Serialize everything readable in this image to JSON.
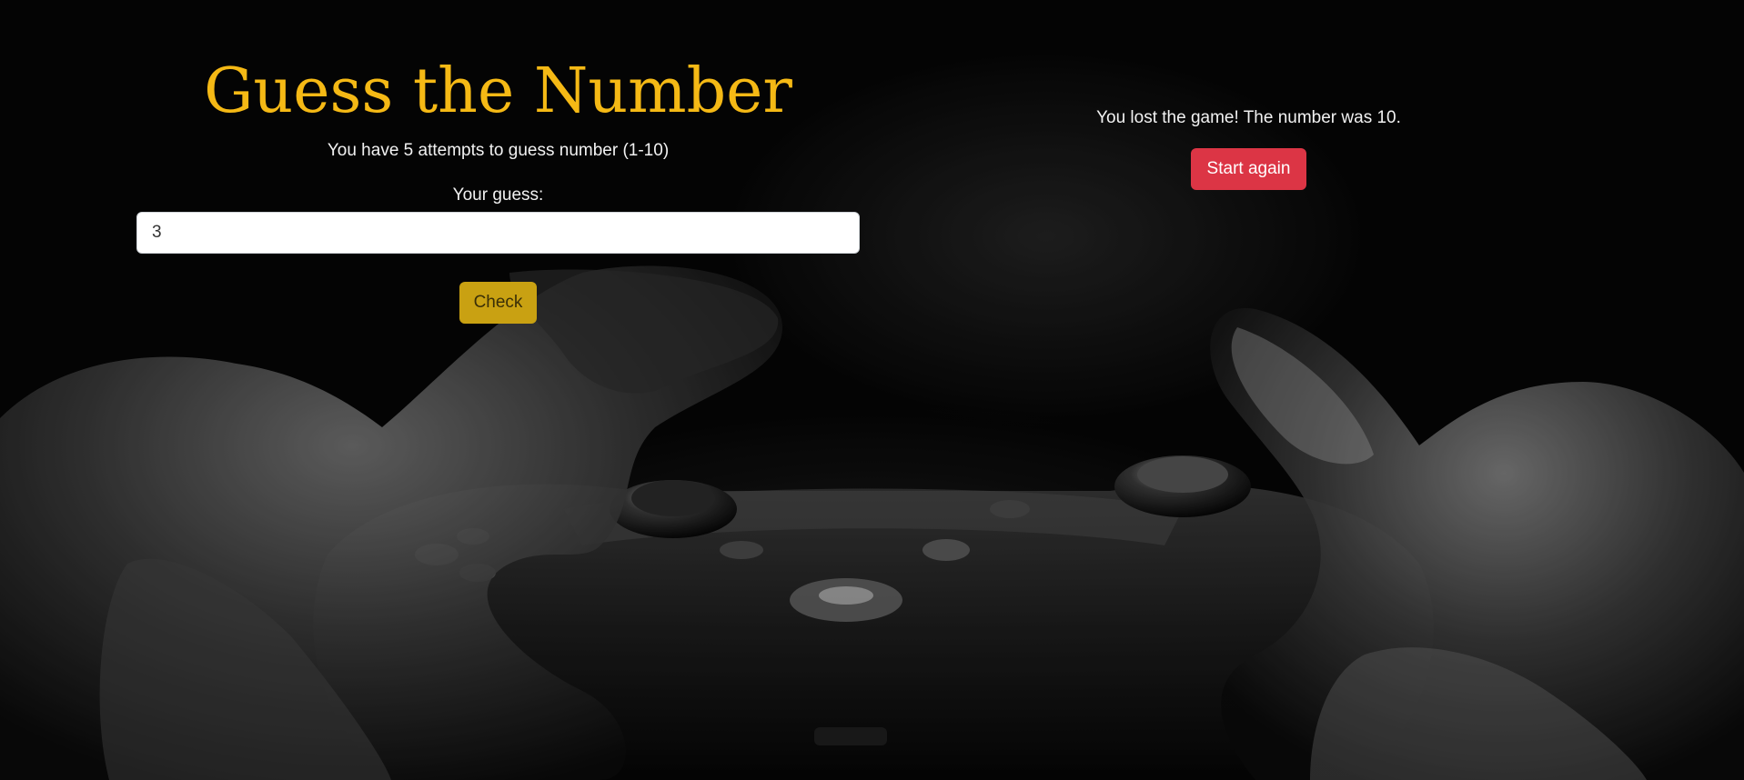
{
  "game": {
    "title": "Guess the Number",
    "instructions": "You have 5 attempts to guess number (1-10)",
    "guess_label": "Your guess:",
    "guess_value": "3",
    "check_label": "Check"
  },
  "result": {
    "message": "You lost the game! The number was 10.",
    "restart_label": "Start again"
  },
  "colors": {
    "title": "#f5b915",
    "check_button": "#c9a112",
    "restart_button": "#dc3545",
    "background": "#050505"
  },
  "background_image": "game-controller-hands-photo"
}
